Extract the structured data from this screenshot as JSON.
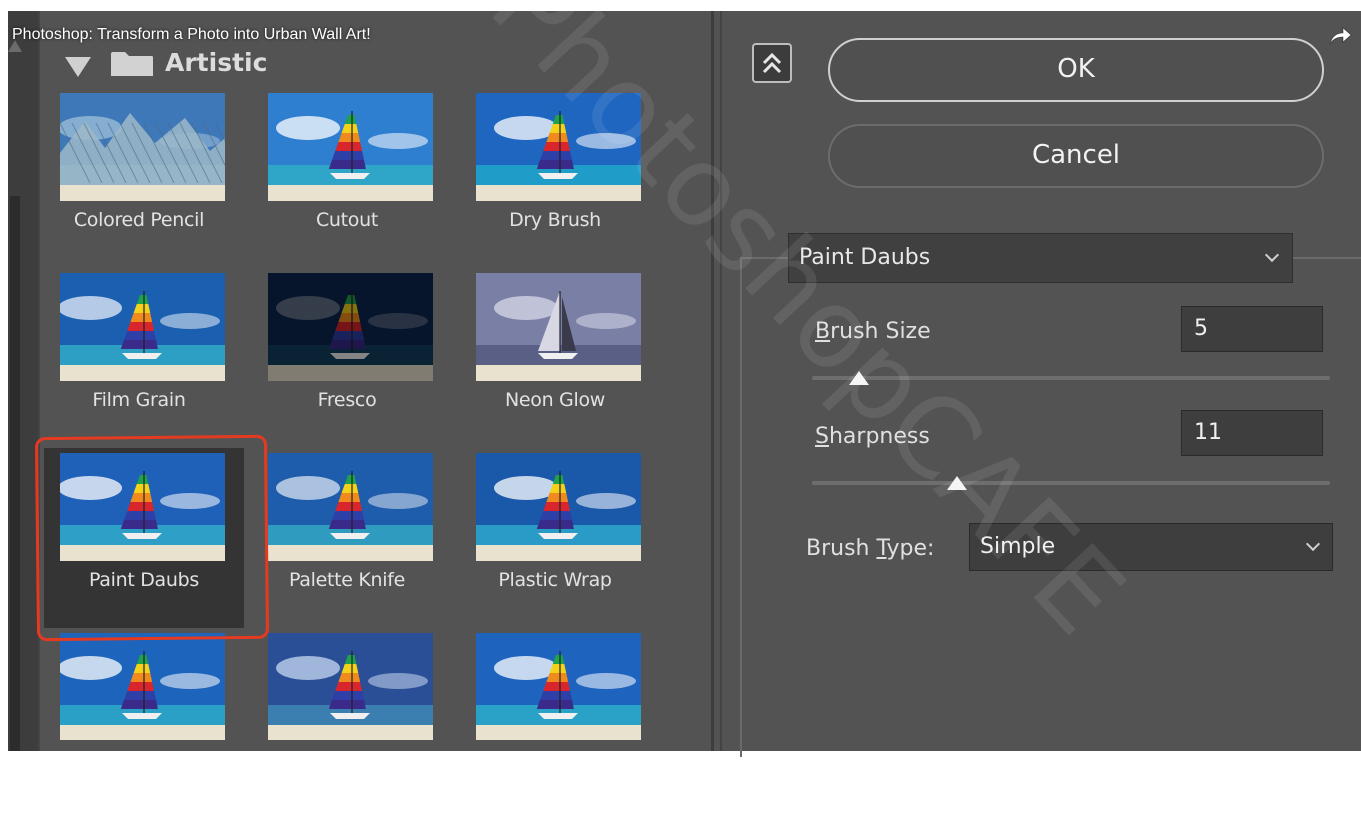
{
  "video": {
    "title": "Photoshop: Transform a Photo into Urban Wall Art!",
    "share_icon": "share-arrow-icon"
  },
  "gallery": {
    "category": "Artistic",
    "category_icons": [
      "disclosure-triangle-icon",
      "folder-icon"
    ],
    "filters": [
      {
        "label": "Colored Pencil",
        "selected": false
      },
      {
        "label": "Cutout",
        "selected": false
      },
      {
        "label": "Dry Brush",
        "selected": false
      },
      {
        "label": "Film Grain",
        "selected": false
      },
      {
        "label": "Fresco",
        "selected": false
      },
      {
        "label": "Neon Glow",
        "selected": false
      },
      {
        "label": "Paint Daubs",
        "selected": true
      },
      {
        "label": "Palette Knife",
        "selected": false
      },
      {
        "label": "Plastic Wrap",
        "selected": false
      },
      {
        "label": "",
        "selected": false
      },
      {
        "label": "",
        "selected": false
      },
      {
        "label": "",
        "selected": false
      }
    ]
  },
  "dialog": {
    "collapse_icon": "double-chevron-up-icon",
    "ok_label": "OK",
    "cancel_label": "Cancel",
    "filter_select": "Paint Daubs",
    "params": {
      "brush_size": {
        "mnemonic": "B",
        "label_rest": "rush Size",
        "value": "5",
        "level_fraction": 0.09
      },
      "sharpness": {
        "mnemonic": "S",
        "label_rest": "harpness",
        "value": "11",
        "level_fraction": 0.28
      },
      "brush_type": {
        "label_pre": "Brush ",
        "mnemonic": "T",
        "label_post": "ype:",
        "value": "Simple"
      }
    }
  },
  "watermark": "PhotoshopCAFE",
  "colors": {
    "panel_bg": "#535353",
    "selection_outline": "#e53a22",
    "field_bg": "#3e3e3e"
  }
}
